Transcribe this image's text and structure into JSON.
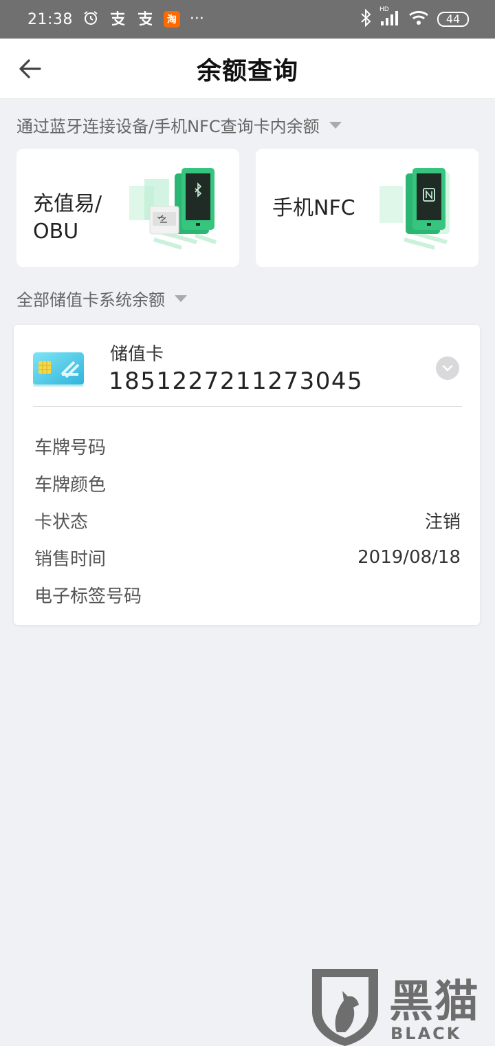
{
  "status_bar": {
    "time": "21:38",
    "icons": [
      "alarm-icon",
      "alipay-icon",
      "alipay-icon",
      "taobao-icon",
      "more-dots-icon"
    ],
    "taobao_label": "淘",
    "more": "···",
    "right_icons": [
      "bluetooth-icon",
      "signal-icon",
      "wifi-icon"
    ],
    "signal_label": "HD",
    "battery": "44"
  },
  "header": {
    "title": "余额查询"
  },
  "device_section": {
    "label": "通过蓝牙连接设备/手机NFC查询卡内余额",
    "cards": [
      {
        "line1": "充值易/",
        "line2": "OBU",
        "icon": "bluetooth-phone-icon"
      },
      {
        "line1": "手机NFC",
        "icon": "nfc-phone-icon"
      }
    ]
  },
  "balance_section": {
    "label": "全部储值卡系统余额"
  },
  "card": {
    "type": "储值卡",
    "number": "1851227211273045",
    "rows": [
      {
        "key": "车牌号码",
        "value": ""
      },
      {
        "key": "车牌颜色",
        "value": ""
      },
      {
        "key": "卡状态",
        "value": "注销"
      },
      {
        "key": "销售时间",
        "value": "2019/08/18"
      },
      {
        "key": "电子标签号码",
        "value": ""
      }
    ]
  },
  "watermark": {
    "title": "黑猫",
    "subtitle": "BLACK CAT"
  },
  "colors": {
    "accent_green": "#2bb673",
    "card_blue": "#3ec9e6",
    "background": "#f0f1f5"
  }
}
